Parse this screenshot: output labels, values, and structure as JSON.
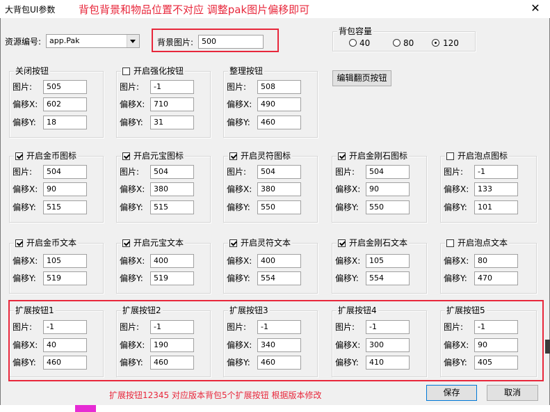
{
  "window": {
    "title": "大背包UI参数",
    "close_symbol": "✕"
  },
  "annotations": {
    "top": "背包背景和物品位置不对应 调整pak图片偏移即可",
    "bottom": "扩展按钮12345 对应版本背包5个扩展按钮 根据版本修改"
  },
  "resource": {
    "label": "资源编号:",
    "value": "app.Pak"
  },
  "background": {
    "label": "背景图片:",
    "value": "500"
  },
  "capacity": {
    "title": "背包容量",
    "options": [
      {
        "label": "40",
        "selected": false
      },
      {
        "label": "80",
        "selected": false
      },
      {
        "label": "120",
        "selected": true
      }
    ]
  },
  "labels": {
    "image": "图片:",
    "offset_x": "偏移X:",
    "offset_y": "偏移Y:"
  },
  "row1": [
    {
      "title": "关闭按钮",
      "checkbox": false,
      "image": "505",
      "x": "602",
      "y": "18"
    },
    {
      "title": "开启强化按钮",
      "checkbox": true,
      "checked": false,
      "image": "-1",
      "x": "710",
      "y": "31"
    },
    {
      "title": "整理按钮",
      "checkbox": false,
      "image": "508",
      "x": "490",
      "y": "460"
    }
  ],
  "edit_page_button": "编辑翻页按钮",
  "icons_row": [
    {
      "title": "开启金币图标",
      "checked": true,
      "image": "504",
      "x": "90",
      "y": "515"
    },
    {
      "title": "开启元宝图标",
      "checked": true,
      "image": "504",
      "x": "380",
      "y": "515"
    },
    {
      "title": "开启灵符图标",
      "checked": true,
      "image": "504",
      "x": "380",
      "y": "550"
    },
    {
      "title": "开启金刚石图标",
      "checked": true,
      "image": "504",
      "x": "90",
      "y": "550"
    },
    {
      "title": "开启泡点图标",
      "checked": false,
      "image": "-1",
      "x": "133",
      "y": "101"
    }
  ],
  "text_row": [
    {
      "title": "开启金币文本",
      "checked": true,
      "x": "105",
      "y": "519"
    },
    {
      "title": "开启元宝文本",
      "checked": true,
      "x": "400",
      "y": "519"
    },
    {
      "title": "开启灵符文本",
      "checked": true,
      "x": "400",
      "y": "554"
    },
    {
      "title": "开启金刚石文本",
      "checked": true,
      "x": "105",
      "y": "554"
    },
    {
      "title": "开启泡点文本",
      "checked": false,
      "x": "80",
      "y": "470"
    }
  ],
  "ext_row": [
    {
      "title": "扩展按钮1",
      "image": "-1",
      "x": "40",
      "y": "460"
    },
    {
      "title": "扩展按钮2",
      "image": "-1",
      "x": "190",
      "y": "460"
    },
    {
      "title": "扩展按钮3",
      "image": "-1",
      "x": "340",
      "y": "460"
    },
    {
      "title": "扩展按钮4",
      "image": "-1",
      "x": "300",
      "y": "410"
    },
    {
      "title": "扩展按钮5",
      "image": "-1",
      "x": "90",
      "y": "405"
    }
  ],
  "buttons": {
    "save": "保存",
    "cancel": "取消"
  },
  "colors": {
    "annotation": "#e8273b",
    "background": "#f0f0f0"
  }
}
